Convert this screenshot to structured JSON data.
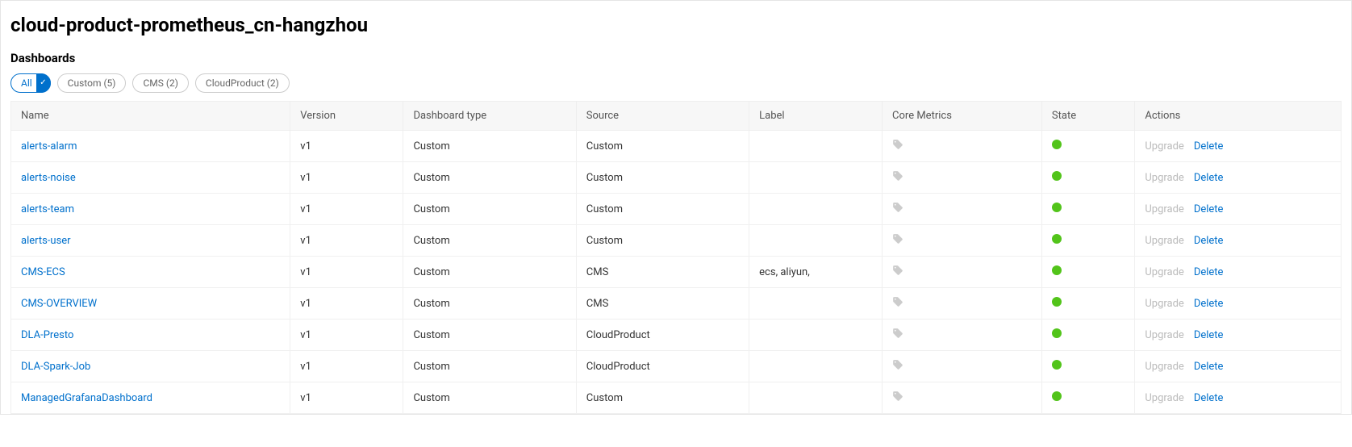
{
  "page_title": "cloud-product-prometheus_cn-hangzhou",
  "section_title": "Dashboards",
  "filters": [
    {
      "label": "All",
      "active": true
    },
    {
      "label": "Custom (5)",
      "active": false
    },
    {
      "label": "CMS (2)",
      "active": false
    },
    {
      "label": "CloudProduct (2)",
      "active": false
    }
  ],
  "columns": {
    "name": "Name",
    "version": "Version",
    "type": "Dashboard type",
    "source": "Source",
    "label": "Label",
    "core": "Core Metrics",
    "state": "State",
    "actions": "Actions"
  },
  "action_labels": {
    "upgrade": "Upgrade",
    "delete": "Delete"
  },
  "rows": [
    {
      "name": "alerts-alarm",
      "version": "v1",
      "type": "Custom",
      "source": "Custom",
      "label": "",
      "state": "ok"
    },
    {
      "name": "alerts-noise",
      "version": "v1",
      "type": "Custom",
      "source": "Custom",
      "label": "",
      "state": "ok"
    },
    {
      "name": "alerts-team",
      "version": "v1",
      "type": "Custom",
      "source": "Custom",
      "label": "",
      "state": "ok"
    },
    {
      "name": "alerts-user",
      "version": "v1",
      "type": "Custom",
      "source": "Custom",
      "label": "",
      "state": "ok"
    },
    {
      "name": "CMS-ECS",
      "version": "v1",
      "type": "Custom",
      "source": "CMS",
      "label": "ecs, aliyun,",
      "state": "ok"
    },
    {
      "name": "CMS-OVERVIEW",
      "version": "v1",
      "type": "Custom",
      "source": "CMS",
      "label": "",
      "state": "ok"
    },
    {
      "name": "DLA-Presto",
      "version": "v1",
      "type": "Custom",
      "source": "CloudProduct",
      "label": "",
      "state": "ok"
    },
    {
      "name": "DLA-Spark-Job",
      "version": "v1",
      "type": "Custom",
      "source": "CloudProduct",
      "label": "",
      "state": "ok"
    },
    {
      "name": "ManagedGrafanaDashboard",
      "version": "v1",
      "type": "Custom",
      "source": "Custom",
      "label": "",
      "state": "ok"
    }
  ],
  "colors": {
    "link": "#0070cc",
    "state_ok": "#52c41a",
    "muted": "#bbbbbb"
  }
}
